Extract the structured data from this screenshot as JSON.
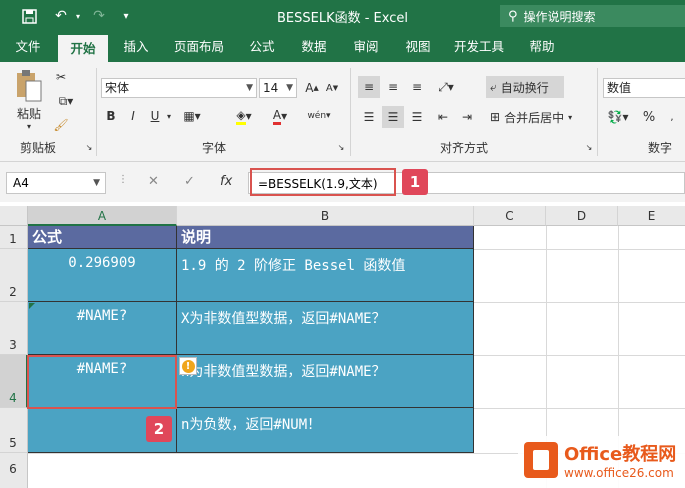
{
  "titlebar": {
    "title": "BESSELK函数  -  Excel",
    "search_placeholder": "操作说明搜索"
  },
  "tabs": [
    "文件",
    "开始",
    "插入",
    "页面布局",
    "公式",
    "数据",
    "审阅",
    "视图",
    "开发工具",
    "帮助"
  ],
  "ribbon": {
    "clipboard": {
      "paste": "粘贴",
      "label": "剪贴板"
    },
    "font": {
      "family": "宋体",
      "size": "14",
      "bold": "B",
      "italic": "I",
      "underline": "U",
      "label": "字体"
    },
    "alignment": {
      "wrap": "自动换行",
      "merge": "合并后居中",
      "label": "对齐方式"
    },
    "number": {
      "format": "数值",
      "label": "数字",
      "percent": "%"
    }
  },
  "formula_bar": {
    "name_box": "A4",
    "fx": "fx",
    "formula": "=BESSELK(1.9,文本)"
  },
  "columns": [
    "A",
    "B",
    "C",
    "D",
    "E"
  ],
  "rows": [
    "1",
    "2",
    "3",
    "4",
    "5",
    "6"
  ],
  "cells": {
    "a1": "公式",
    "b1": "说明",
    "a2": "0.296909",
    "b2": "1.9 的 2 阶修正 Bessel 函数值",
    "a3": "#NAME?",
    "b3": "X为非数值型数据，返回#NAME？",
    "a4": "#NAME?",
    "b4": "n为非数值型数据，返回#NAME？",
    "a5": "",
    "b5": "n为负数，返回#NUM！"
  },
  "badges": [
    "1",
    "2"
  ],
  "watermark": {
    "title": "Office教程网",
    "url": "www.office26.com"
  },
  "colors": {
    "excel_green": "#217346",
    "header_fill": "#5b6aa0",
    "body_fill": "#4ba3c3",
    "highlight_red": "#d9534f"
  }
}
